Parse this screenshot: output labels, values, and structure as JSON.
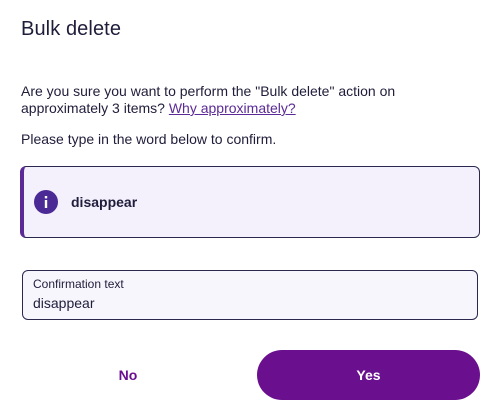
{
  "dialog": {
    "title": "Bulk delete",
    "message_text": "Are you sure you want to perform the \"Bulk delete\" action on approximately 3 items? ",
    "message_link": "Why approximately?",
    "instruction": "Please type in the word below to confirm.",
    "info": {
      "icon": "info-icon",
      "word": "disappear"
    },
    "confirmation_field": {
      "label": "Confirmation text",
      "value": "disappear",
      "placeholder": ""
    },
    "buttons": {
      "no_label": "No",
      "yes_label": "Yes"
    }
  },
  "colors": {
    "primary": "#6a0f8e",
    "info_icon_bg": "#4b2a96",
    "info_box_bg": "#f4f1fd",
    "link": "#5b2a96",
    "text": "#1f1d3a"
  }
}
